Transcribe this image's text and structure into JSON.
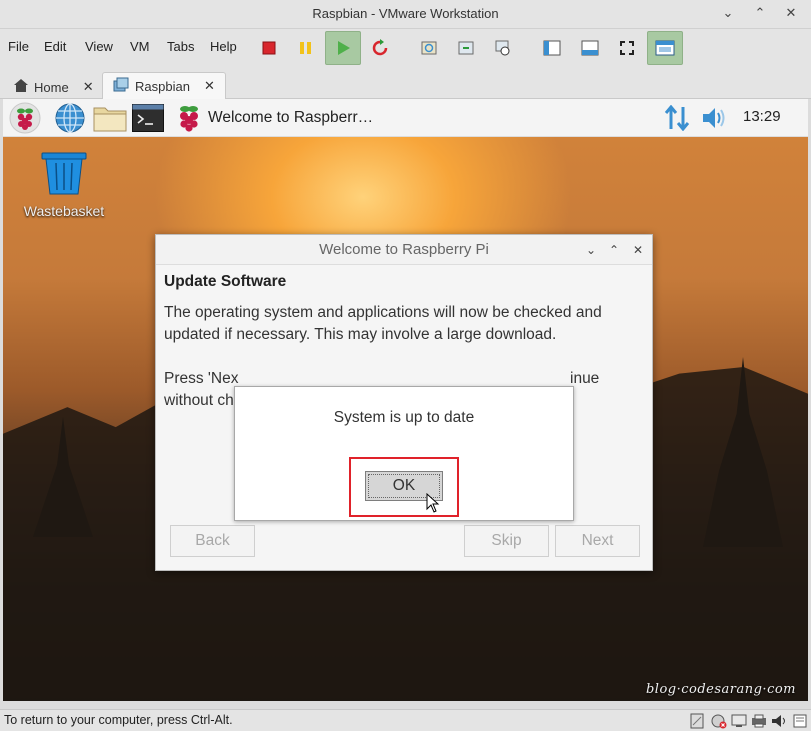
{
  "window": {
    "title": "Raspbian - VMware Workstation"
  },
  "menu": [
    "File",
    "Edit",
    "View",
    "VM",
    "Tabs",
    "Help"
  ],
  "tabs": [
    {
      "label": "Home",
      "active": false
    },
    {
      "label": "Raspbian",
      "active": true
    }
  ],
  "guest_panel": {
    "task_title": "Welcome to Raspberr…",
    "clock": "13:29"
  },
  "desktop": {
    "trash_label": "Wastebasket",
    "watermark": "blog·codesarang·com"
  },
  "welcome_dialog": {
    "title": "Welcome to Raspberry Pi",
    "heading": "Update Software",
    "paragraph1_line1": "The operating system and applications will now be checked and",
    "paragraph1_line2": "updated if necessary. This may involve a large download.",
    "paragraph2_line1_left": "Press 'Nex",
    "paragraph2_line1_right": "inue",
    "paragraph2_line2_left": "without ch",
    "buttons": {
      "back": "Back",
      "skip": "Skip",
      "next": "Next"
    }
  },
  "message_box": {
    "message": "System is up to date",
    "ok": "OK"
  },
  "statusbar": {
    "text": "To return to your computer, press Ctrl-Alt."
  },
  "colors": {
    "highlight": "#e0222a",
    "raspberry": "#c51a4a",
    "accent_blue": "#3a8fd0"
  }
}
